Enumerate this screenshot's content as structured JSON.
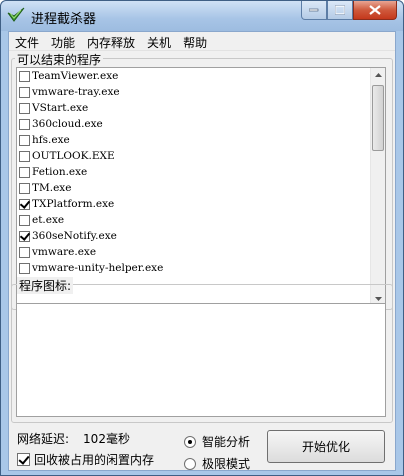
{
  "window": {
    "title": "进程截杀器"
  },
  "menu": [
    "文件",
    "功能",
    "内存释放",
    "关机",
    "帮助"
  ],
  "process_group": {
    "caption": "可以结束的程序",
    "items": [
      {
        "name": "TeamViewer.exe",
        "checked": false
      },
      {
        "name": "vmware-tray.exe",
        "checked": false
      },
      {
        "name": "VStart.exe",
        "checked": false
      },
      {
        "name": "360cloud.exe",
        "checked": false
      },
      {
        "name": "hfs.exe",
        "checked": false
      },
      {
        "name": "OUTLOOK.EXE",
        "checked": false
      },
      {
        "name": "Fetion.exe",
        "checked": false
      },
      {
        "name": "TM.exe",
        "checked": false
      },
      {
        "name": "TXPlatform.exe",
        "checked": true
      },
      {
        "name": "et.exe",
        "checked": false
      },
      {
        "name": "360seNotify.exe",
        "checked": true
      },
      {
        "name": "vmware.exe",
        "checked": false
      },
      {
        "name": "vmware-unity-helper.exe",
        "checked": false
      }
    ]
  },
  "icons_group": {
    "caption": "程序图标:"
  },
  "latency": {
    "label": "网络延迟:",
    "value": "102毫秒"
  },
  "recycle": {
    "label": "回收被占用的闲置内存",
    "checked": true
  },
  "modes": {
    "smart_label": "智能分析",
    "smart_selected": true,
    "extreme_label": "极限模式",
    "extreme_selected": false
  },
  "start_button": "开始优化",
  "icons": {
    "app": "shield-check-icon",
    "minimize": "minimize-icon",
    "maximize": "maximize-icon",
    "close": "close-icon",
    "scroll_up": "scroll-up-arrow-icon",
    "scroll_down": "scroll-down-arrow-icon"
  }
}
